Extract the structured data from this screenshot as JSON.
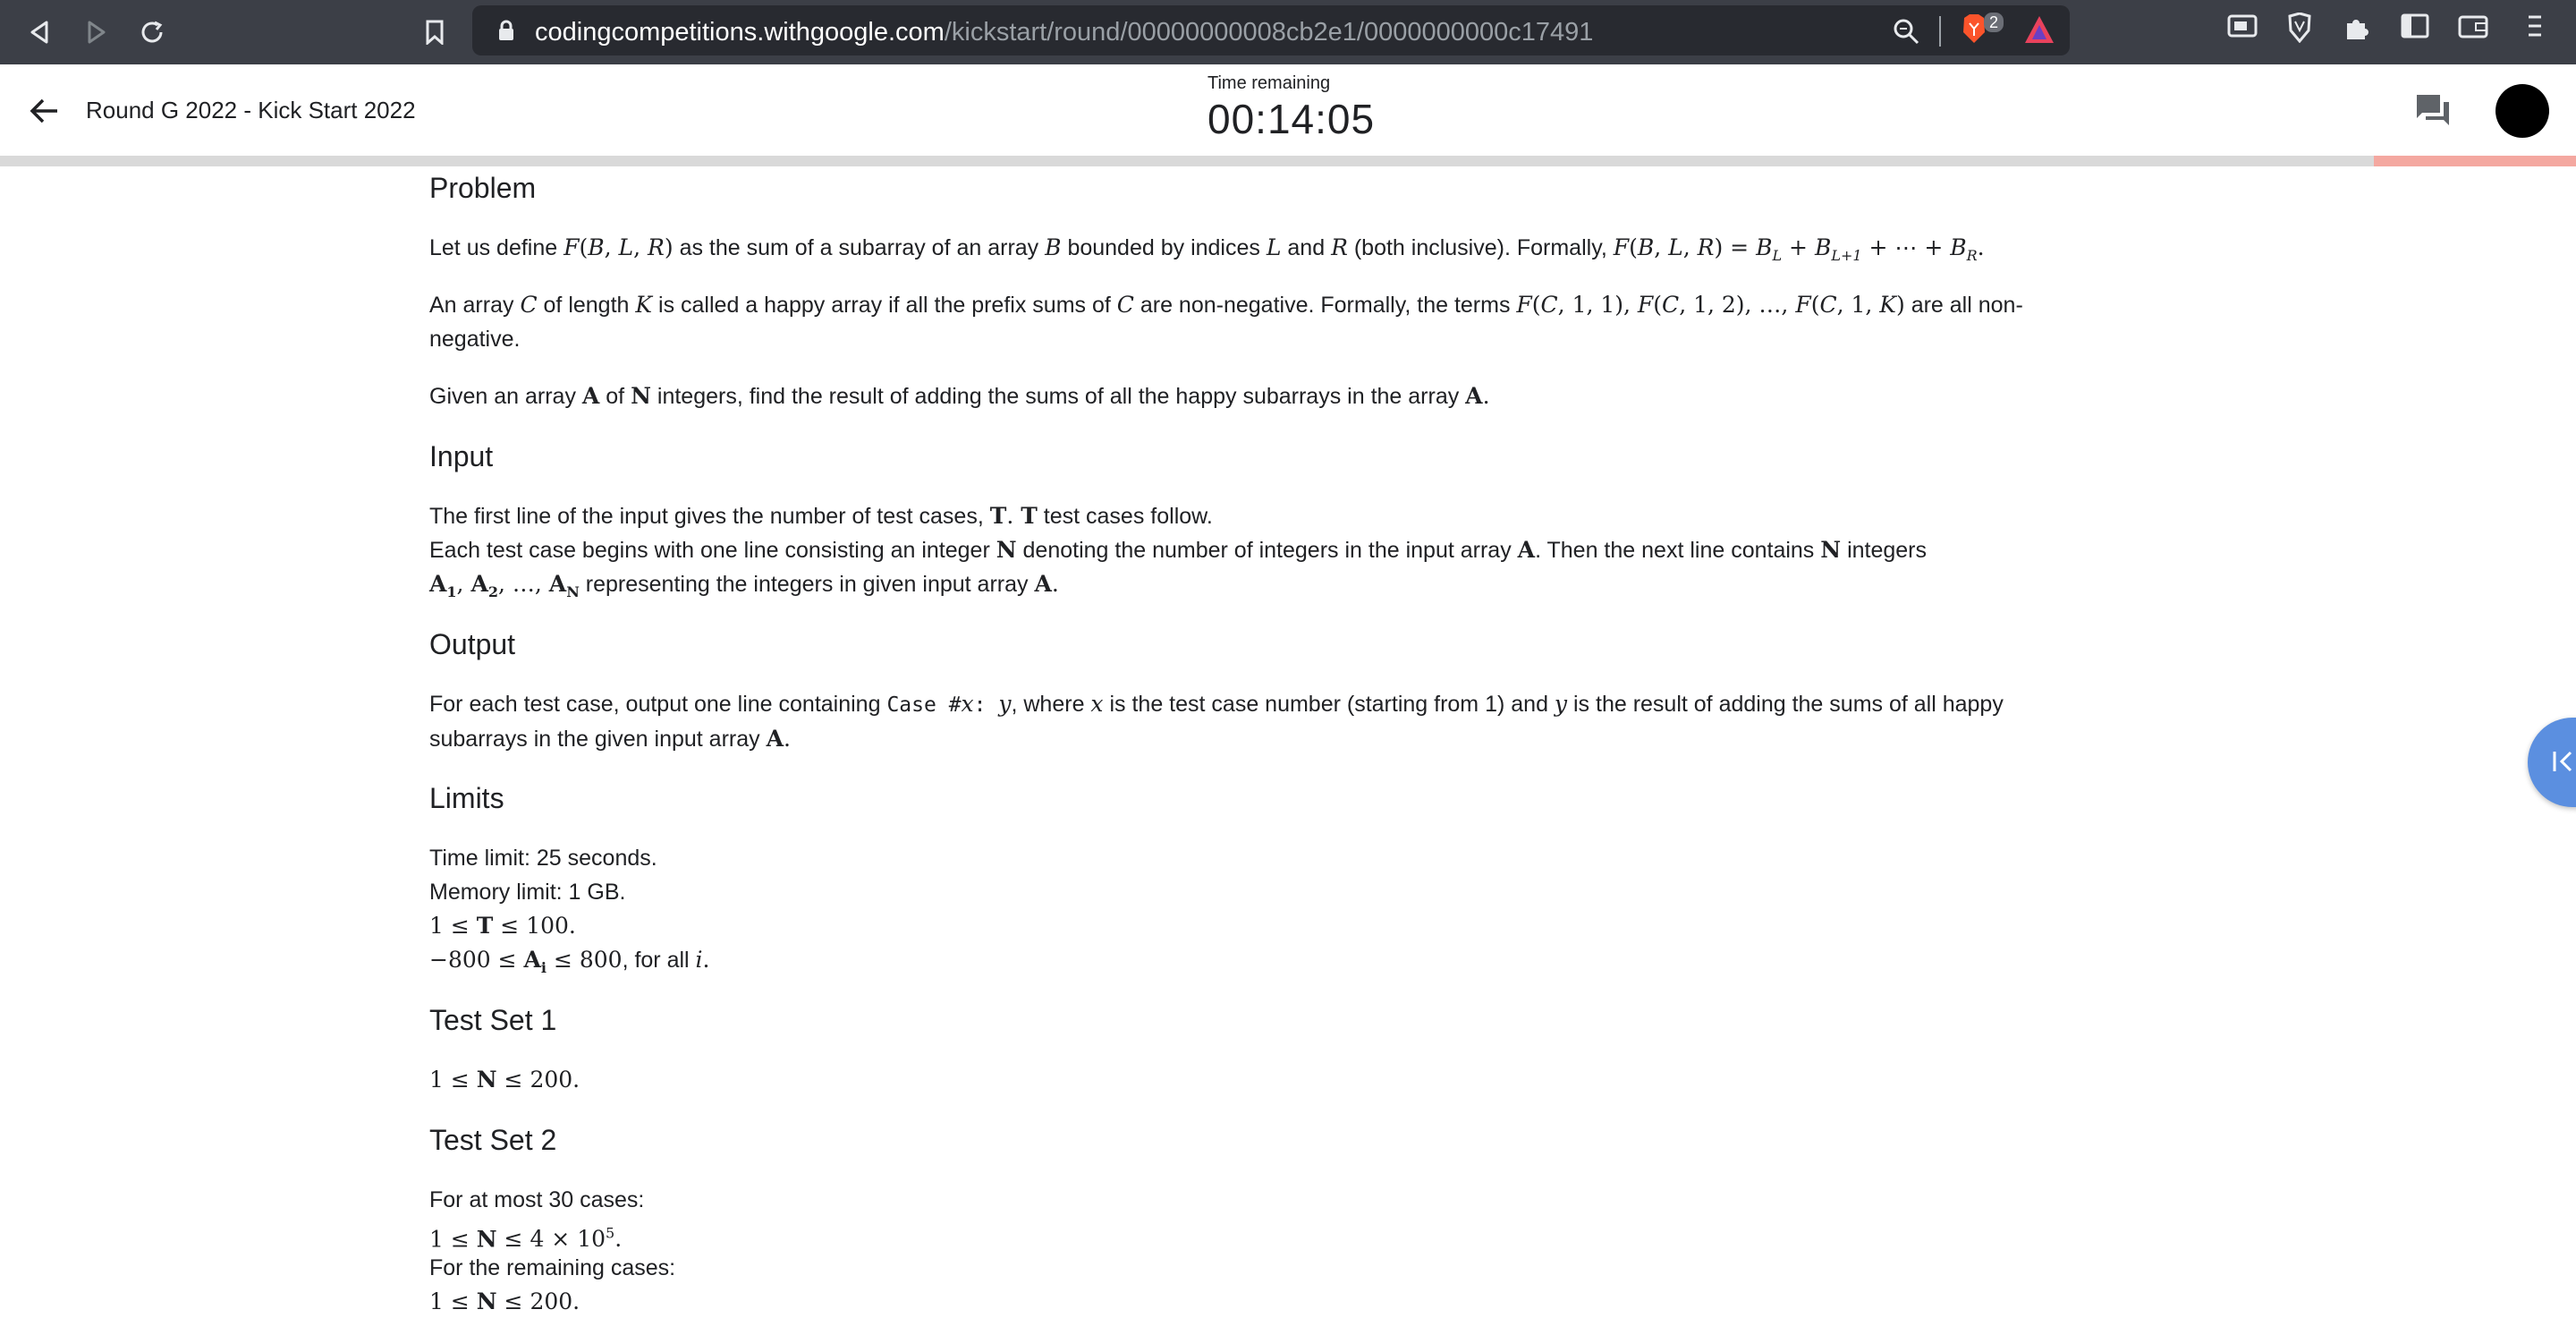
{
  "browser": {
    "url_host": "codingcompetitions.withgoogle.com",
    "url_path": "/kickstart/round/00000000008cb2e1/0000000000c17491",
    "brave_badge_count": "2"
  },
  "header": {
    "round_title": "Round G 2022 - Kick Start 2022",
    "time_label": "Time remaining",
    "time_value": "00:14:05"
  },
  "sections": {
    "problem_heading": "Problem",
    "input_heading": "Input",
    "output_heading": "Output",
    "limits_heading": "Limits",
    "testset1_heading": "Test Set 1",
    "testset2_heading": "Test Set 2"
  },
  "problem": {
    "p1_a": "Let us define ",
    "p1_b": " as the sum of a subarray of an array ",
    "p1_c": " bounded by indices ",
    "p1_d": " and ",
    "p1_e": " (both inclusive). Formally, ",
    "p2_a": "An array ",
    "p2_b": " of length ",
    "p2_c": " is called a happy array if all the prefix sums of ",
    "p2_d": " are non-negative. Formally, the terms ",
    "p2_e": " are all non-negative.",
    "p3_a": "Given an array ",
    "p3_b": " of ",
    "p3_c": " integers, find the result of adding the sums of all the happy subarrays in the array "
  },
  "input": {
    "l1_a": "The first line of the input gives the number of test cases, ",
    "l1_b": " test cases follow.",
    "l2_a": "Each test case begins with one line consisting an integer ",
    "l2_b": " denoting the number of integers in the input array ",
    "l2_c": ". Then the next line contains ",
    "l2_d": " integers",
    "l3_b": " representing the integers in given input array "
  },
  "output": {
    "a": "For each test case, output one line containing ",
    "case_code": "Case #",
    "b": ", where ",
    "c": " is the test case number (starting from 1) and ",
    "d": " is the result of adding the sums of all happy subarrays in the given input array "
  },
  "limits": {
    "time": "Time limit: 25 seconds.",
    "memory": "Memory limit: 1 GB.",
    "for_all": ", for all "
  },
  "testset2": {
    "at_most": "For at most 30 cases:",
    "remaining": "For the remaining cases:"
  }
}
